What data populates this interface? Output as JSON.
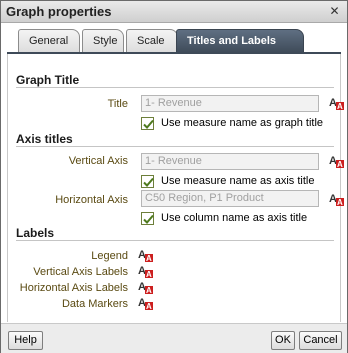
{
  "dialog": {
    "title": "Graph properties",
    "close_glyph": "✕"
  },
  "tabs": [
    {
      "label": "General"
    },
    {
      "label": "Style"
    },
    {
      "label": "Scale"
    },
    {
      "label": "Titles and Labels",
      "active": true
    }
  ],
  "graph_title": {
    "section": "Graph Title",
    "title_label": "Title",
    "title_value": "1- Revenue",
    "use_measure_label": "Use measure name as graph title",
    "use_measure_checked": true,
    "format_icon": "text-format-icon"
  },
  "axis_titles": {
    "section": "Axis titles",
    "vertical_label": "Vertical Axis",
    "vertical_value": "1- Revenue",
    "vertical_use_label": "Use measure name as axis title",
    "vertical_use_checked": true,
    "horizontal_label": "Horizontal Axis",
    "horizontal_value": "C50  Region, P1  Product",
    "horizontal_use_label": "Use column name as axis title",
    "horizontal_use_checked": true
  },
  "labels": {
    "section": "Labels",
    "items": [
      {
        "label": "Legend"
      },
      {
        "label": "Vertical Axis Labels"
      },
      {
        "label": "Horizontal Axis Labels"
      },
      {
        "label": "Data Markers"
      }
    ]
  },
  "footer": {
    "help": "Help",
    "ok": "OK",
    "cancel": "Cancel"
  },
  "colors": {
    "tab_active": "#4a5666",
    "label_text": "#5a4a12",
    "check_green": "#4e7a1e",
    "format_red": "#cc1f1f"
  }
}
